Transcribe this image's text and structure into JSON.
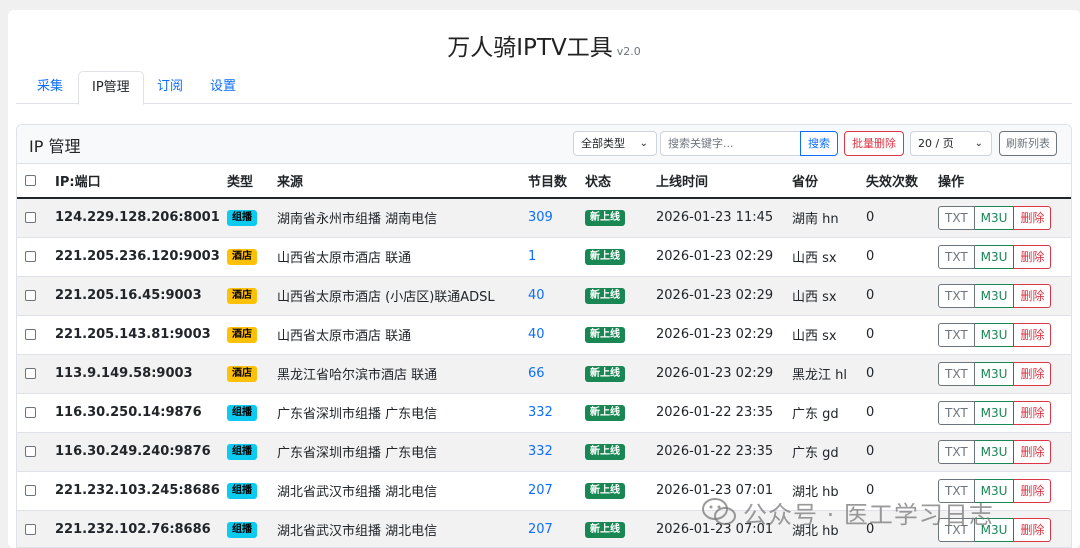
{
  "header": {
    "title": "万人骑IPTV工具",
    "version": "v2.0"
  },
  "tabs": [
    {
      "label": "采集",
      "active": false
    },
    {
      "label": "IP管理",
      "active": true
    },
    {
      "label": "订阅",
      "active": false
    },
    {
      "label": "设置",
      "active": false
    }
  ],
  "panel": {
    "title": "IP 管理",
    "type_filter": "全部类型",
    "search_placeholder": "搜索关键字...",
    "search_label": "搜索",
    "batch_delete_label": "批量删除",
    "page_size": "20 / 页",
    "refresh_label": "刷新列表"
  },
  "table": {
    "columns": [
      "IP:端口",
      "类型",
      "来源",
      "节目数",
      "状态",
      "上线时间",
      "省份",
      "失效次数",
      "操作"
    ],
    "rows": [
      {
        "ip": "124.229.128.206:8001",
        "type": "组播",
        "type_kind": "group",
        "source": "湖南省永州市组播 湖南电信",
        "count": "309",
        "status": "新上线",
        "time": "2026-01-23 11:45",
        "province": "湖南 hn",
        "fails": "0"
      },
      {
        "ip": "221.205.236.120:9003",
        "type": "酒店",
        "type_kind": "hotel",
        "source": "山西省太原市酒店 联通",
        "count": "1",
        "status": "新上线",
        "time": "2026-01-23 02:29",
        "province": "山西 sx",
        "fails": "0"
      },
      {
        "ip": "221.205.16.45:9003",
        "type": "酒店",
        "type_kind": "hotel",
        "source": "山西省太原市酒店 (小店区)联通ADSL",
        "count": "40",
        "status": "新上线",
        "time": "2026-01-23 02:29",
        "province": "山西 sx",
        "fails": "0"
      },
      {
        "ip": "221.205.143.81:9003",
        "type": "酒店",
        "type_kind": "hotel",
        "source": "山西省太原市酒店 联通",
        "count": "40",
        "status": "新上线",
        "time": "2026-01-23 02:29",
        "province": "山西 sx",
        "fails": "0"
      },
      {
        "ip": "113.9.149.58:9003",
        "type": "酒店",
        "type_kind": "hotel",
        "source": "黑龙江省哈尔滨市酒店 联通",
        "count": "66",
        "status": "新上线",
        "time": "2026-01-23 02:29",
        "province": "黑龙江 hl",
        "fails": "0"
      },
      {
        "ip": "116.30.250.14:9876",
        "type": "组播",
        "type_kind": "group",
        "source": "广东省深圳市组播 广东电信",
        "count": "332",
        "status": "新上线",
        "time": "2026-01-22 23:35",
        "province": "广东 gd",
        "fails": "0"
      },
      {
        "ip": "116.30.249.240:9876",
        "type": "组播",
        "type_kind": "group",
        "source": "广东省深圳市组播 广东电信",
        "count": "332",
        "status": "新上线",
        "time": "2026-01-22 23:35",
        "province": "广东 gd",
        "fails": "0"
      },
      {
        "ip": "221.232.103.245:8686",
        "type": "组播",
        "type_kind": "group",
        "source": "湖北省武汉市组播 湖北电信",
        "count": "207",
        "status": "新上线",
        "time": "2026-01-23 07:01",
        "province": "湖北 hb",
        "fails": "0"
      },
      {
        "ip": "221.232.102.76:8686",
        "type": "组播",
        "type_kind": "group",
        "source": "湖北省武汉市组播 湖北电信",
        "count": "207",
        "status": "新上线",
        "time": "2026-01-23 07:01",
        "province": "湖北 hb",
        "fails": "0"
      }
    ],
    "actions": {
      "txt": "TXT",
      "m3u": "M3U",
      "delete": "删除"
    }
  },
  "watermark": {
    "text": "公众号 · 医工学习日志"
  },
  "colors": {
    "primary": "#0d6efd",
    "success": "#198754",
    "danger": "#dc3545",
    "info": "#0dcaf0",
    "warning": "#ffc107"
  }
}
